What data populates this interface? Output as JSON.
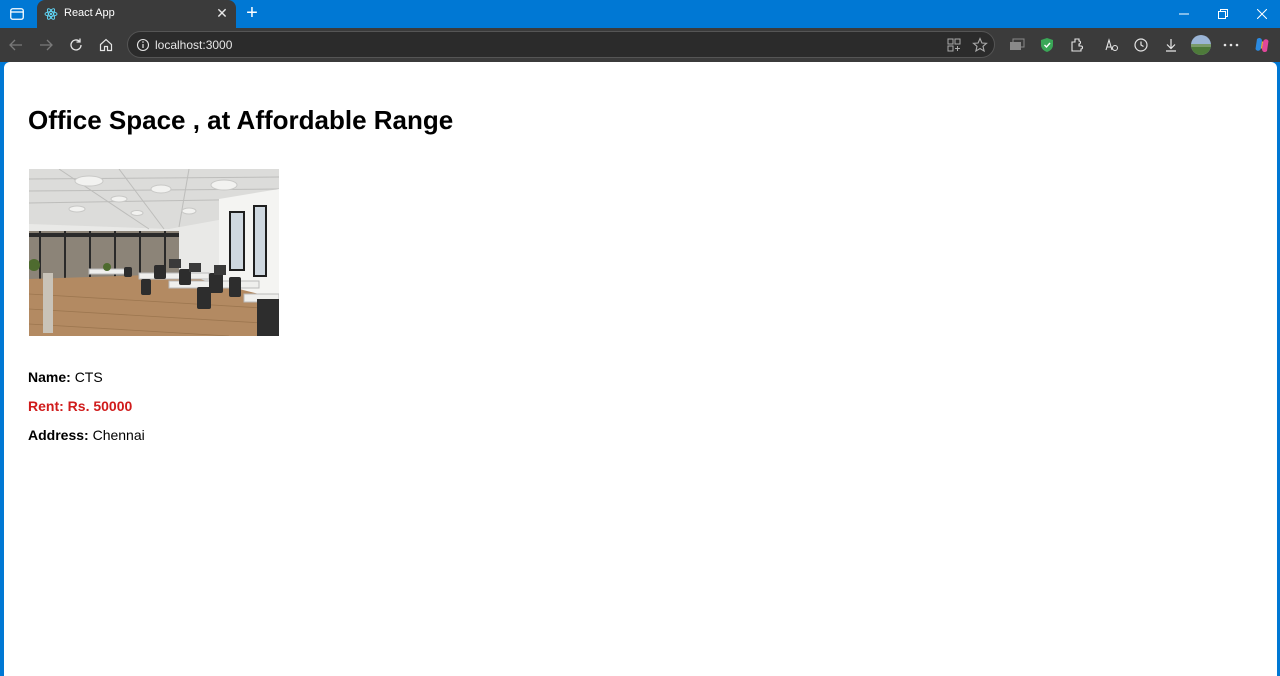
{
  "browser": {
    "tab_title": "React App",
    "address": "localhost:3000"
  },
  "page": {
    "heading": "Office Space , at Affordable Range",
    "image_alt": "Office space photo",
    "name_label": "Name:",
    "name_value": "CTS",
    "rent_label": "Rent:",
    "rent_value": "Rs. 50000",
    "address_label": "Address:",
    "address_value": "Chennai",
    "rent_color": "#d01b1b"
  }
}
